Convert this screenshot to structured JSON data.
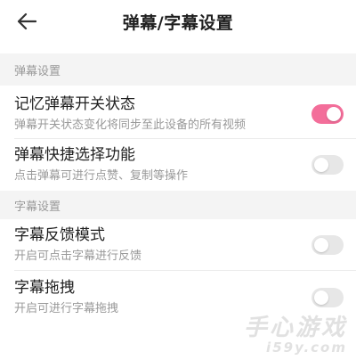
{
  "header": {
    "title": "弹幕/字幕设置",
    "back_icon": "arrow-left-icon"
  },
  "sections": [
    {
      "label": "弹幕设置",
      "items": [
        {
          "title": "记忆弹幕开关状态",
          "desc": "弹幕开关状态变化将同步至此设备的所有视频",
          "enabled": true
        },
        {
          "title": "弹幕快捷选择功能",
          "desc": "点击弹幕可进行点赞、复制等操作",
          "enabled": false
        }
      ]
    },
    {
      "label": "字幕设置",
      "items": [
        {
          "title": "字幕反馈模式",
          "desc": "开启可点击字幕进行反馈",
          "enabled": false
        },
        {
          "title": "字幕拖拽",
          "desc": "开启可进行字幕拖拽",
          "enabled": false
        }
      ]
    }
  ],
  "colors": {
    "toggle_on": "#f36e9a",
    "toggle_off": "#e7e7e7",
    "section_bg": "#f4f4f4"
  },
  "watermark": {
    "main": "手心游戏",
    "sub": "i59y.com"
  }
}
